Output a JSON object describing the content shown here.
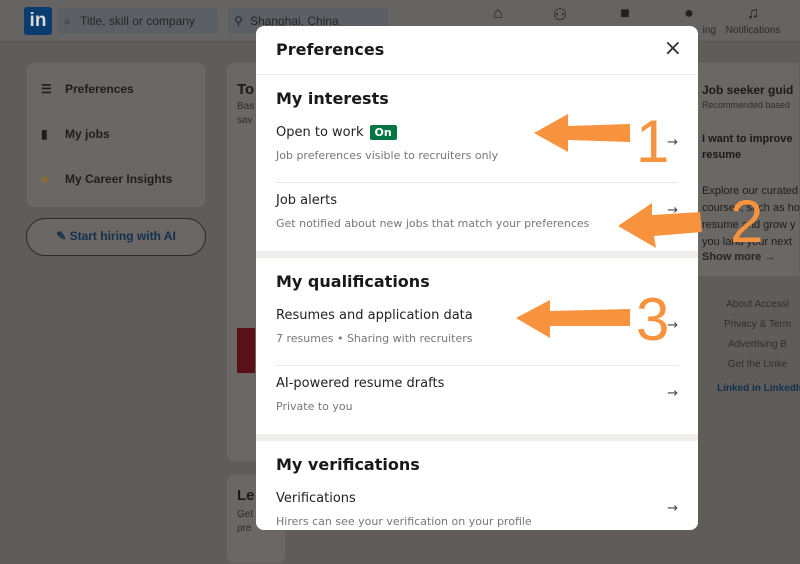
{
  "nav": {
    "logo": "in",
    "search_placeholder": "Title, skill or company",
    "location": "Shanghai, China",
    "items": [
      {
        "icon": "home-icon",
        "label": ""
      },
      {
        "icon": "people-icon",
        "label": ""
      },
      {
        "icon": "jobs-icon",
        "label": ""
      },
      {
        "icon": "messaging-icon",
        "label": "ing"
      },
      {
        "icon": "bell-icon",
        "label": "Notifications"
      }
    ]
  },
  "sidebar": {
    "items": [
      {
        "icon": "list-icon",
        "label": "Preferences"
      },
      {
        "icon": "bookmark-icon",
        "label": "My jobs"
      },
      {
        "icon": "insights-icon",
        "label": "My Career Insights"
      }
    ],
    "hire_button": "Start hiring with AI"
  },
  "center": {
    "card1_title": "To",
    "card1_sub1": "Bas",
    "card1_sub2": "sav",
    "card2_title": "Le",
    "card2_sub1": "Get",
    "card2_sub2": "pre"
  },
  "right": {
    "title": "Job seeker guid",
    "subtitle": "Recommended based",
    "headline": "I want to improve",
    "headline2": "resume",
    "body": [
      "Explore our curated",
      "courses, such as ho",
      "resume and grow y",
      "you land your next"
    ],
    "show_more": "Show more →",
    "footer": [
      "About   Accessi",
      "Privacy & Term",
      "Advertising   B",
      "Get the Linke"
    ],
    "brand": "Linked in LinkedIn"
  },
  "modal": {
    "title": "Preferences",
    "close": "×",
    "sections": [
      {
        "title": "My interests",
        "rows": [
          {
            "title": "Open to work",
            "badge": "On",
            "subtitle": "Job preferences visible to recruiters only"
          },
          {
            "title": "Job alerts",
            "subtitle": "Get notified about new jobs that match your preferences"
          }
        ]
      },
      {
        "title": "My qualifications",
        "rows": [
          {
            "title": "Resumes and application data",
            "subtitle": "7 resumes • Sharing with recruiters"
          },
          {
            "title": "AI-powered resume drafts",
            "subtitle": "Private to you"
          }
        ]
      },
      {
        "title": "My verifications",
        "rows": [
          {
            "title": "Verifications",
            "subtitle": "Hirers can see your verification on your profile"
          }
        ]
      }
    ]
  },
  "annotations": {
    "color": "#f7923e",
    "labels": [
      "1",
      "2",
      "3"
    ]
  }
}
